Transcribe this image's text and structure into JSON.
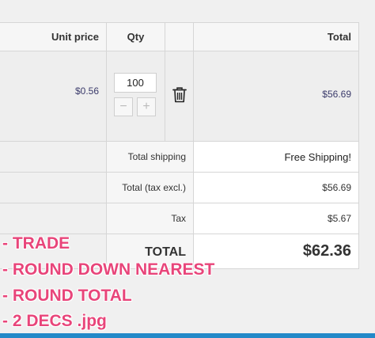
{
  "cart": {
    "headers": {
      "unit_price": "Unit price",
      "qty": "Qty",
      "total": "Total"
    },
    "item": {
      "unit_price": "$0.56",
      "quantity": "100",
      "minus": "−",
      "plus": "+",
      "total": "$56.69"
    },
    "summary": {
      "shipping_label": "Total shipping",
      "shipping_value": "Free Shipping!",
      "tax_excl_label": "Total (tax excl.)",
      "tax_excl_value": "$56.69",
      "tax_label": "Tax",
      "tax_value": "$5.67",
      "grand_label": "TOTAL",
      "grand_value": "$62.36"
    }
  },
  "annotations": [
    "- TRADE",
    "- ROUND DOWN NEAREST",
    "- ROUND TOTAL",
    "- 2 DECS .jpg"
  ],
  "colors": {
    "annotation": "#e8457a",
    "bottom_bar": "#2389c8"
  },
  "icons": {
    "trash": "trash-icon"
  }
}
